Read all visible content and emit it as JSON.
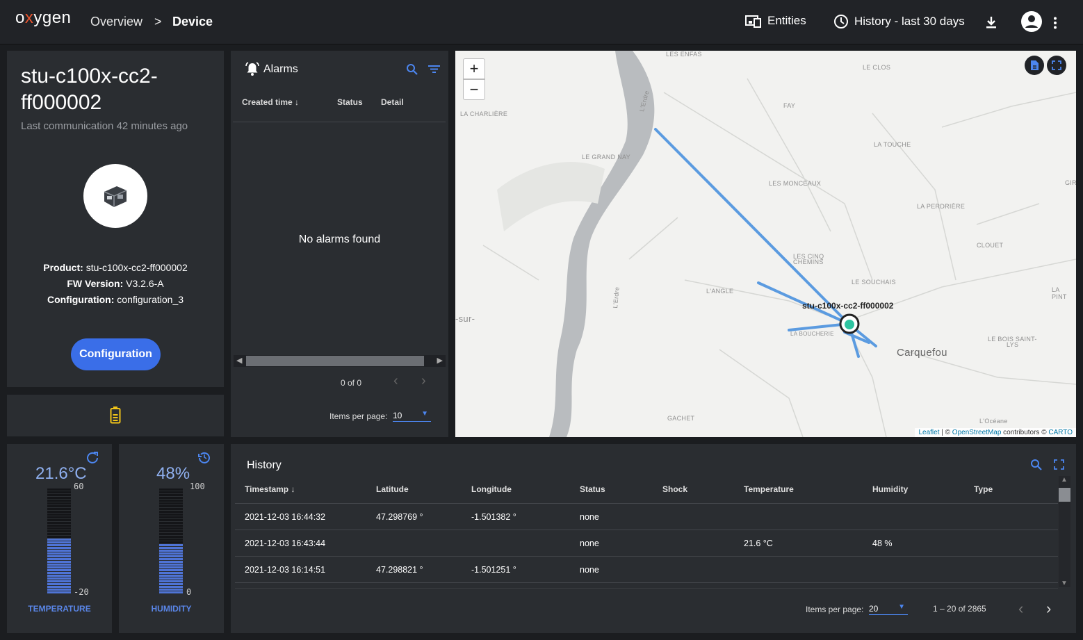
{
  "app": {
    "logo_pre": "o",
    "logo_x": "x",
    "logo_post": "ygen"
  },
  "breadcrumb": {
    "overview": "Overview",
    "separator": ">",
    "current": "Device"
  },
  "topbar": {
    "entities_label": "Entities",
    "history_label": "History - last 30 days"
  },
  "device": {
    "title": "stu-c100x-cc2-ff000002",
    "last_comm": "Last communication 42 minutes ago",
    "product_label": "Product:",
    "product_value": "stu-c100x-cc2-ff000002",
    "fw_label": "FW Version:",
    "fw_value": "V3.2.6-A",
    "cfg_label": "Configuration:",
    "cfg_value": "configuration_3",
    "config_button": "Configuration"
  },
  "alarms": {
    "title": "Alarms",
    "columns": [
      "Created time",
      "Status",
      "Detail"
    ],
    "empty": "No alarms found",
    "range": "0 of 0",
    "items_label": "Items per page:",
    "items_value": "10"
  },
  "map": {
    "labels": [
      "LES ENFAS",
      "LE CLOS",
      "LA CHARLIÈRE",
      "FAY",
      "LE GRAND NAY",
      "LA TOUCHE",
      "LES MONCEAUX",
      "GIR",
      "LA PERDRIÈRE",
      "CLOUET",
      "LES CINQ",
      "CHEMINS",
      "LE SOUCHAIS",
      "L'ANGLE",
      "LA PINT",
      "-sur-",
      "LA BOUCHERIE",
      "LE BOIS SAINT-",
      "LYS",
      "Carquefou",
      "GACHET",
      "L'Océane",
      "L'Erdre",
      "L'Erdre"
    ],
    "marker_label": "stu-c100x-cc2-ff000002",
    "attribution_leaflet": "Leaflet",
    "attribution_sep": " | © ",
    "attribution_osm": "OpenStreetMap",
    "attribution_mid": " contributors © ",
    "attribution_carto": "CARTO",
    "zoom_in": "+",
    "zoom_out": "−"
  },
  "temperature": {
    "value": "21.6°C",
    "max": "60",
    "min": "-20",
    "label": "TEMPERATURE",
    "level": 0.52
  },
  "humidity": {
    "value": "48%",
    "max": "100",
    "min": "0",
    "label": "HUMIDITY",
    "level": 0.48
  },
  "history": {
    "title": "History",
    "columns": [
      "Timestamp",
      "Latitude",
      "Longitude",
      "Status",
      "Shock",
      "Temperature",
      "Humidity",
      "Type"
    ],
    "rows": [
      [
        "2021-12-03 16:44:32",
        "47.298769 °",
        "-1.501382 °",
        "none",
        "",
        "",
        "",
        ""
      ],
      [
        "2021-12-03 16:43:44",
        "",
        "",
        "none",
        "",
        "21.6 °C",
        "48 %",
        ""
      ],
      [
        "2021-12-03 16:14:51",
        "47.298821 °",
        "-1.501251 °",
        "none",
        "",
        "",
        "",
        ""
      ]
    ],
    "items_label": "Items per page:",
    "items_value": "20",
    "range": "1 – 20 of 2865"
  },
  "colors": {
    "accent": "#3a6ee8",
    "battery": "#f0c419",
    "route": "#5b9be0",
    "marker": "#2ec4a0"
  }
}
